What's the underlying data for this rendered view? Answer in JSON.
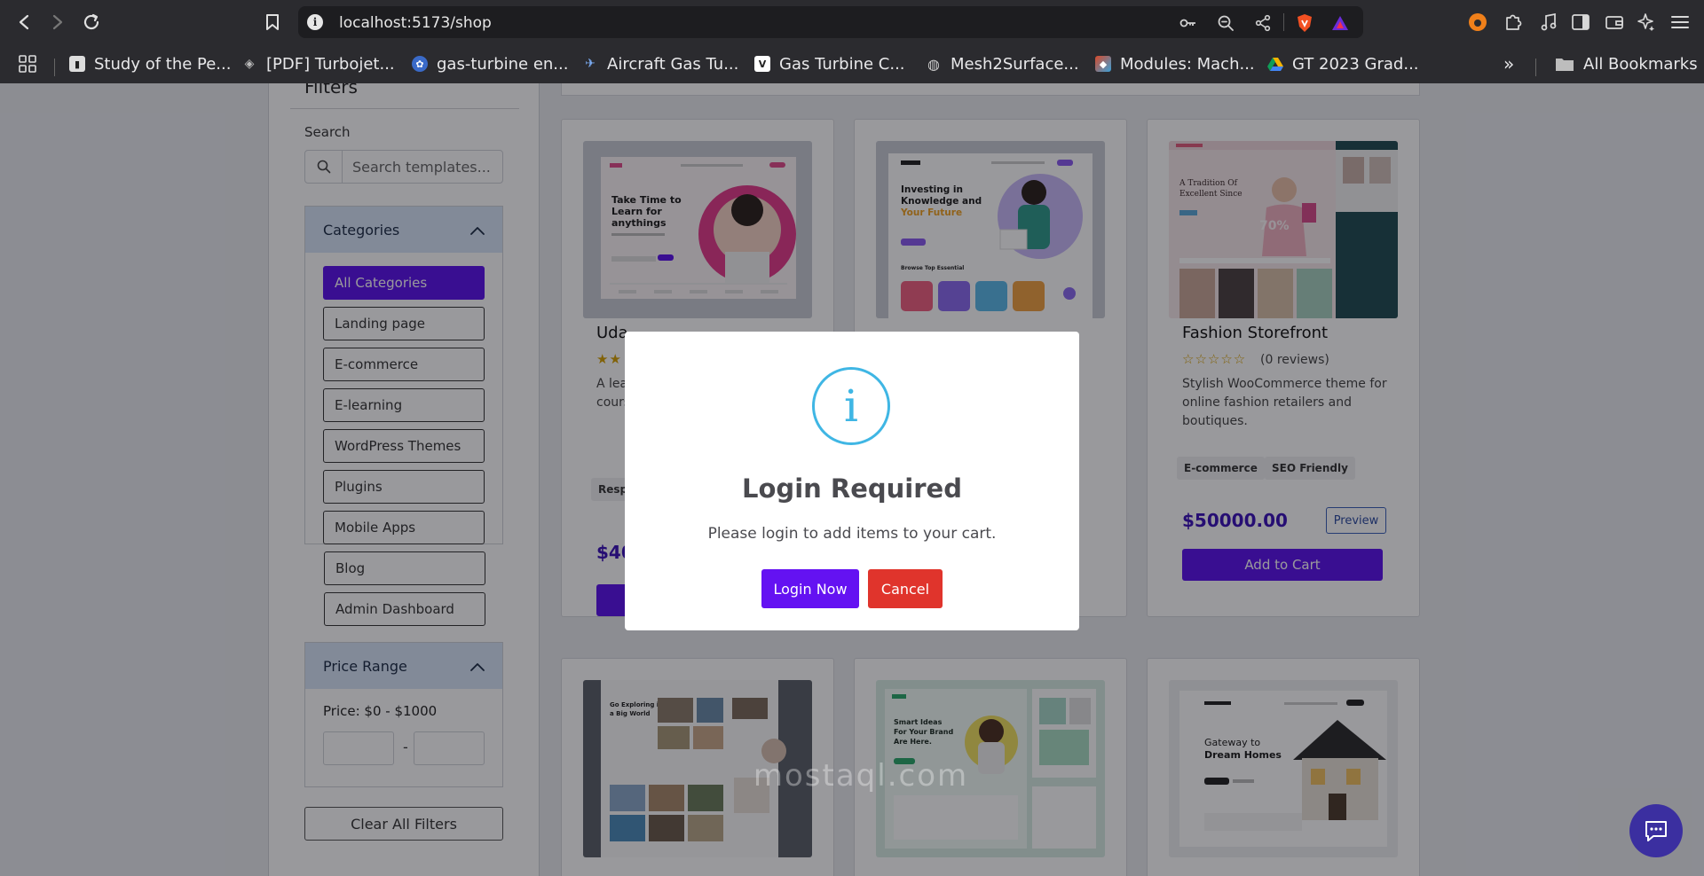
{
  "browser": {
    "url": "localhost:5173/shop",
    "bookmarks": [
      {
        "label": "Study of the Pe...",
        "color": "#dddddd"
      },
      {
        "label": "[PDF] Turbojet...",
        "color": "#888888"
      },
      {
        "label": "gas-turbine en...",
        "color": "#4a8ad8"
      },
      {
        "label": "Aircraft Gas Tu...",
        "color": "#5a8ad8"
      },
      {
        "label": "Gas Turbine C...",
        "color": "#ffffff"
      },
      {
        "label": "Mesh2Surface...",
        "color": "#aaaaaa"
      },
      {
        "label": "Modules: Mach...",
        "color": "#d84a2a"
      },
      {
        "label": "GT 2023 Grad...",
        "color": "#3a8ad8"
      }
    ],
    "all_bookmarks": "All Bookmarks",
    "overflow": "»"
  },
  "sidebar": {
    "title": "Filters",
    "search_label": "Search",
    "search_placeholder": "Search templates...",
    "categories_title": "Categories",
    "categories": [
      {
        "label": "All Categories",
        "active": true
      },
      {
        "label": "Landing page",
        "active": false
      },
      {
        "label": "E-commerce",
        "active": false
      },
      {
        "label": "E-learning",
        "active": false
      },
      {
        "label": "WordPress Themes",
        "active": false
      },
      {
        "label": "Plugins",
        "active": false
      },
      {
        "label": "Mobile Apps",
        "active": false
      },
      {
        "label": "Blog",
        "active": false
      },
      {
        "label": "Admin Dashboard",
        "active": false
      }
    ],
    "price_title": "Price Range",
    "price_text": "Price: $0 - $1000",
    "price_dash": "-",
    "clear_label": "Clear All Filters"
  },
  "products": [
    {
      "title": "Uda",
      "stars": "★★",
      "reviews": "",
      "desc": "A lea cours",
      "tags": [
        "Resp"
      ],
      "price": "$40",
      "preview": "",
      "cart": ""
    },
    {
      "title": "",
      "stars": "",
      "reviews": "",
      "desc": "",
      "tags": [],
      "price": "",
      "preview": "",
      "cart": ""
    },
    {
      "title": "Fashion Storefront",
      "stars": "☆☆☆☆☆",
      "reviews": "(0 reviews)",
      "desc": "Stylish WooCommerce theme for online fashion retailers and boutiques.",
      "tags": [
        "E-commerce",
        "SEO Friendly"
      ],
      "price": "$50000.00",
      "preview": "Preview",
      "cart": "Add to Cart"
    }
  ],
  "thumbs": {
    "t1": {
      "headline": "Take Time to Learn for anythings"
    },
    "t2": {
      "headline": "Investing in Knowledge and",
      "accent": "Your Future"
    },
    "t3": {
      "headline": "A Tradition Of Excellent Since",
      "badge": "70%"
    },
    "t4": {
      "headline": "Go Exploring in a Big World"
    },
    "t5": {
      "headline": "Smart Ideas For Your Brand Are Here."
    },
    "t6": {
      "headline": "Gateway to",
      "accent": "Dream Homes"
    }
  },
  "modal": {
    "icon": "i",
    "title": "Login Required",
    "message": "Please login to add items to your cart.",
    "login_label": "Login Now",
    "cancel_label": "Cancel"
  },
  "watermark": "mostaql.com",
  "colors": {
    "primary": "#5a11ec",
    "danger": "#e0342c",
    "info": "#3fb6e4",
    "price": "#3a10b8"
  }
}
